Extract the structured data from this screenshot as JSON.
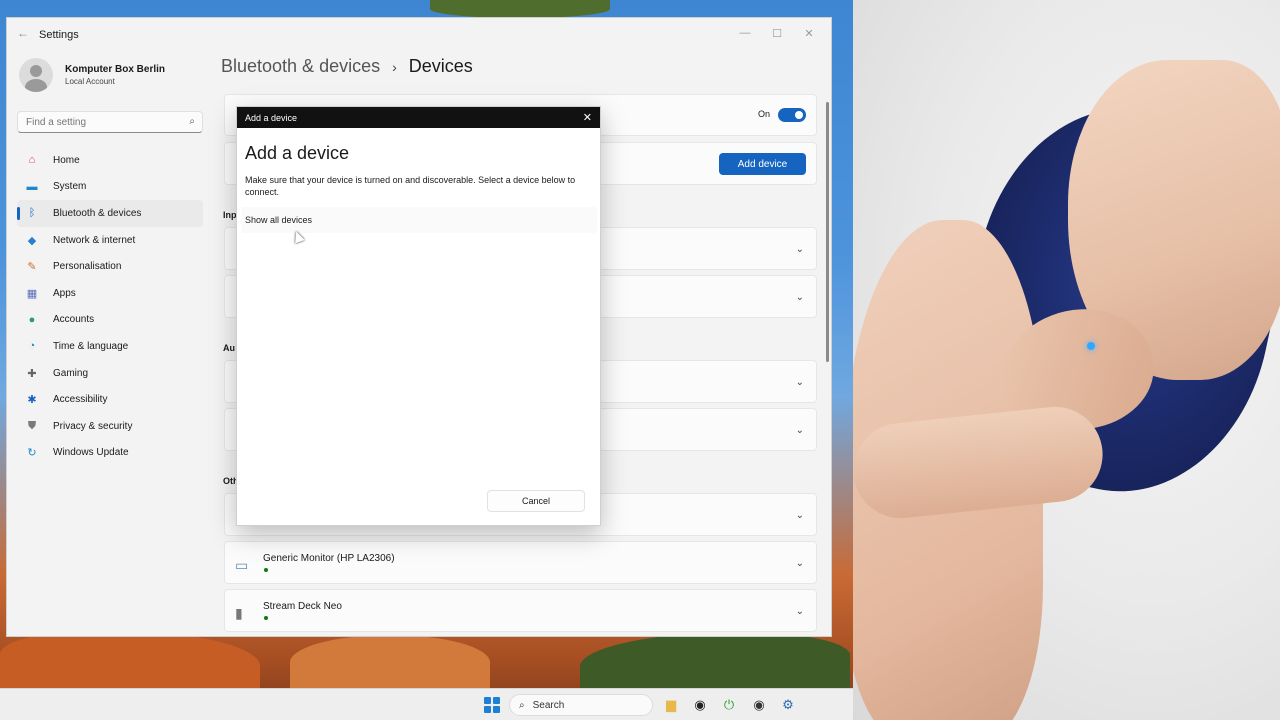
{
  "settings_window": {
    "app_title": "Settings",
    "controls": {
      "minimize": "—",
      "maximize": "☐",
      "close": "✕"
    },
    "profile": {
      "name": "Komputer Box Berlin",
      "account_type": "Local Account"
    },
    "search": {
      "placeholder": "Find a setting"
    },
    "nav": [
      {
        "label": "Home",
        "icon": "home-icon",
        "glyph": "⌂",
        "color": "#d8453b"
      },
      {
        "label": "System",
        "icon": "system-icon",
        "glyph": "▬",
        "color": "#1e88c8"
      },
      {
        "label": "Bluetooth & devices",
        "icon": "bluetooth-icon",
        "glyph": "ᛒ",
        "color": "#1565c0",
        "active": true
      },
      {
        "label": "Network & internet",
        "icon": "network-icon",
        "glyph": "◆",
        "color": "#2a7fd0"
      },
      {
        "label": "Personalisation",
        "icon": "paintbrush-icon",
        "glyph": "✎",
        "color": "#c8702a"
      },
      {
        "label": "Apps",
        "icon": "apps-icon",
        "glyph": "▦",
        "color": "#5c6bc0"
      },
      {
        "label": "Accounts",
        "icon": "accounts-icon",
        "glyph": "●",
        "color": "#22a06b"
      },
      {
        "label": "Time & language",
        "icon": "time-language-icon",
        "glyph": "◔",
        "color": "#1e88c8"
      },
      {
        "label": "Gaming",
        "icon": "gaming-icon",
        "glyph": "✚",
        "color": "#666666"
      },
      {
        "label": "Accessibility",
        "icon": "accessibility-icon",
        "glyph": "✱",
        "color": "#1565c0"
      },
      {
        "label": "Privacy & security",
        "icon": "shield-icon",
        "glyph": "⛊",
        "color": "#7a7a7a"
      },
      {
        "label": "Windows Update",
        "icon": "update-icon",
        "glyph": "↻",
        "color": "#1e88c8"
      }
    ],
    "breadcrumb": {
      "parent": "Bluetooth & devices",
      "separator": "›",
      "current": "Devices"
    },
    "bluetooth_toggle": {
      "label": "On",
      "state": "on"
    },
    "add_device_button": "Add device",
    "sections": {
      "input": "Inp",
      "audio": "Au",
      "other": "Oth"
    },
    "devices": [
      {
        "name": "Generic Monitor (HP LA2306)",
        "icon": "monitor-icon",
        "status": "connected"
      },
      {
        "name": "Stream Deck Neo",
        "icon": "device-icon",
        "status": "connected"
      }
    ]
  },
  "dialog": {
    "title_bar": "Add a device",
    "heading": "Add a device",
    "description": "Make sure that your device is turned on and discoverable. Select a device below to connect.",
    "show_all": "Show all devices",
    "cancel": "Cancel",
    "close": "✕"
  },
  "taskbar": {
    "search_label": "Search",
    "pinned": [
      {
        "icon": "file-explorer-icon",
        "glyph": "▆",
        "color": "#e8b84a"
      },
      {
        "icon": "obs-icon",
        "glyph": "◉",
        "color": "#222222"
      },
      {
        "icon": "power-icon",
        "glyph": "⏻",
        "color": "#2e9e2e"
      },
      {
        "icon": "app-icon",
        "glyph": "◉",
        "color": "#333333"
      },
      {
        "icon": "settings-gear-icon",
        "glyph": "⚙",
        "color": "#2b6cb0"
      }
    ]
  },
  "colors": {
    "accent": "#1565c0",
    "dialog_titlebar": "#111111"
  }
}
